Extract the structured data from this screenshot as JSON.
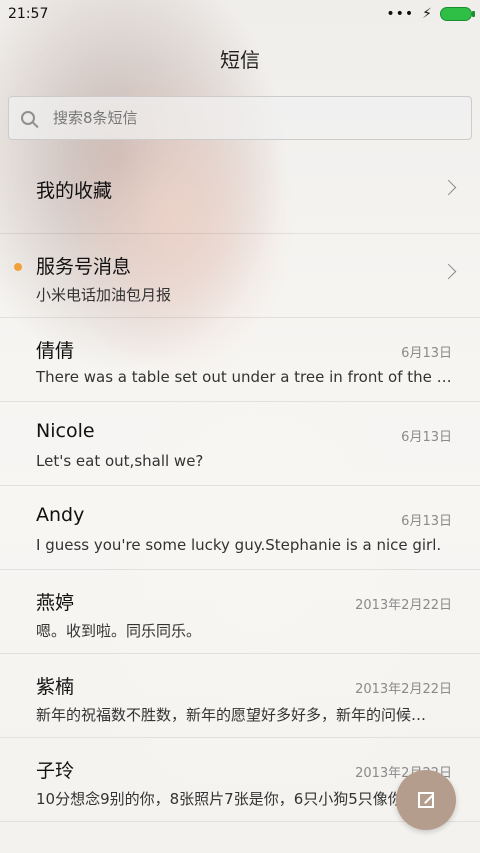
{
  "status_bar": {
    "time": "21:57",
    "signal_dots": "•••",
    "charging_icon": "bolt-icon",
    "battery_color": "#2fbf46"
  },
  "header": {
    "title": "短信"
  },
  "search": {
    "placeholder": "搜索8条短信"
  },
  "list": {
    "items": [
      {
        "title": "我的收藏",
        "subtitle": "",
        "date": "",
        "has_chevron": true,
        "unread": false
      },
      {
        "title": "服务号消息",
        "subtitle": "小米电话加油包月报",
        "date": "",
        "has_chevron": true,
        "unread": true
      },
      {
        "title": "倩倩",
        "subtitle": "There was a table set out under a tree in front of the ho…",
        "date": "6月13日",
        "has_chevron": false,
        "unread": false
      },
      {
        "title": "Nicole",
        "subtitle": "Let's eat out,shall we?",
        "date": "6月13日",
        "has_chevron": false,
        "unread": false
      },
      {
        "title": "Andy",
        "subtitle": "I guess you're some lucky guy.Stephanie is a nice girl.",
        "date": "6月13日",
        "has_chevron": false,
        "unread": false
      },
      {
        "title": "燕婷",
        "subtitle": "嗯。收到啦。同乐同乐。",
        "date": "2013年2月22日",
        "has_chevron": false,
        "unread": false
      },
      {
        "title": "紫楠",
        "subtitle": "新年的祝福数不胜数，新年的愿望好多好多，新年的问候…",
        "date": "2013年2月22日",
        "has_chevron": false,
        "unread": false
      },
      {
        "title": "子玲",
        "subtitle": "10分想念9别的你，8张照片7张是你，6只小狗5只像你",
        "date": "2013年2月22日",
        "has_chevron": false,
        "unread": false
      }
    ]
  },
  "fab": {
    "icon": "compose-icon",
    "color": "#b59d8d"
  }
}
